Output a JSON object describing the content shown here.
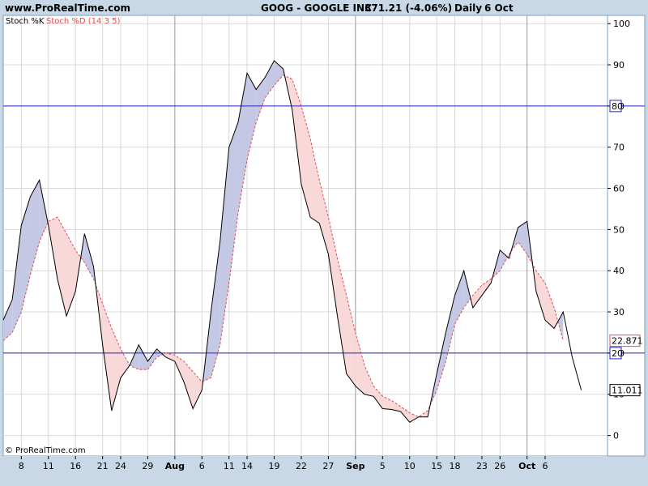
{
  "header": {
    "site": "www.ProRealTime.com",
    "symbol_line": "GOOG - GOOGLE INC",
    "price_change": "371.21 (-4.06%)",
    "period": "Daily",
    "date": "6 Oct",
    "watermark": "© ProRealTime.com"
  },
  "legend": {
    "k_label": "Stoch %K",
    "d_label": "Stoch %D (14 3 5)",
    "k_color": "#000000",
    "d_color": "#e05050"
  },
  "colors": {
    "background": "#ffffff",
    "frame": "#c8d8e6",
    "grid": "#d8d8d8",
    "level_line": "#2222bb",
    "fill_k_above": "#c4c8e4",
    "fill_d_above": "#f8d8d8"
  },
  "chart_data": {
    "type": "line",
    "title": "",
    "xlabel": "",
    "ylabel": "",
    "ylim": [
      -5,
      102
    ],
    "y_ticks": [
      0,
      10,
      20,
      30,
      40,
      50,
      60,
      70,
      80,
      90,
      100
    ],
    "grid": true,
    "x_tick_labels": [
      "8",
      "11",
      "16",
      "21",
      "24",
      "29",
      "Aug",
      "6",
      "11",
      "14",
      "19",
      "22",
      "27",
      "Sep",
      "5",
      "10",
      "15",
      "18",
      "23",
      "26",
      "Oct",
      "6"
    ],
    "x_tick_index": [
      2,
      5,
      8,
      11,
      13,
      16,
      19,
      22,
      25,
      27,
      30,
      33,
      36,
      39,
      42,
      45,
      48,
      50,
      53,
      55,
      58,
      60
    ],
    "bold_ticks": [
      "Aug",
      "Sep",
      "Oct"
    ],
    "month_separators": [
      19,
      39,
      58
    ],
    "levels": [
      80,
      20
    ],
    "last_values": {
      "d": "22.871",
      "k": "11.011"
    },
    "x_count": 62,
    "series": [
      {
        "name": "Stoch %K",
        "values": [
          28,
          33,
          51,
          58,
          62,
          51,
          38,
          29,
          35,
          49,
          41,
          22,
          6,
          14,
          17,
          22,
          18,
          21,
          19,
          18,
          13,
          6.5,
          11,
          30,
          47,
          70,
          76,
          88,
          84,
          87,
          91,
          89,
          79,
          61,
          53,
          51.5,
          44,
          29,
          15,
          12,
          10,
          9.5,
          6.5,
          6.3,
          5.8,
          3.2,
          4.5,
          4.5,
          15,
          25,
          34,
          40,
          31,
          34,
          37,
          45,
          43,
          50.5,
          52,
          35,
          28,
          26,
          30,
          19,
          11
        ]
      },
      {
        "name": "Stoch %D (14 3 5)",
        "values": [
          23,
          25,
          30,
          39,
          47,
          52,
          53,
          49,
          45,
          42,
          38,
          32,
          26,
          21,
          17,
          16,
          16,
          19,
          20,
          19.5,
          18,
          15.5,
          13,
          14,
          22,
          37,
          54,
          67,
          76,
          82,
          85,
          87.5,
          86.5,
          80,
          72,
          62,
          53,
          43,
          34,
          25,
          17,
          12,
          9.5,
          8.5,
          7,
          5.5,
          4.5,
          6,
          11,
          18,
          27,
          31,
          34,
          36.5,
          38,
          40,
          44,
          47,
          44,
          40,
          37,
          31,
          23
        ]
      }
    ]
  }
}
